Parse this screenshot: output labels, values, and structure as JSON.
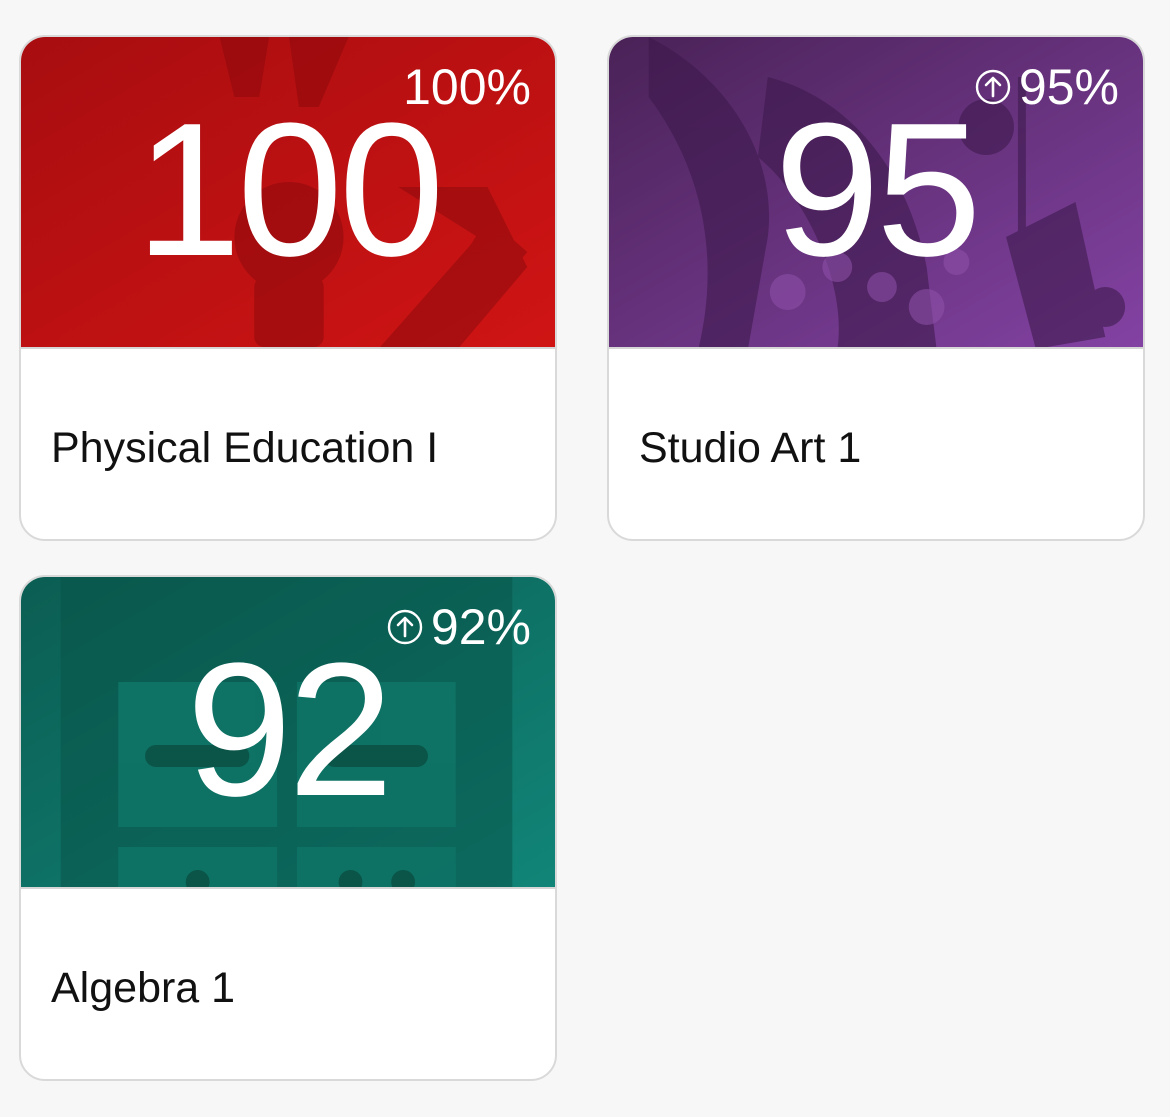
{
  "courses": [
    {
      "name": "Physical Education I",
      "grade": "100",
      "percent": "100%",
      "trend": "none",
      "color": "#c01114",
      "icon": "trophy-icon"
    },
    {
      "name": "Studio Art 1",
      "grade": "95",
      "percent": "95%",
      "trend": "up",
      "color": "#6a3490",
      "icon": "theater-mask-music-icon"
    },
    {
      "name": "Algebra 1",
      "grade": "92",
      "percent": "92%",
      "trend": "up",
      "color": "#0f7a6c",
      "icon": "calculator-icon"
    }
  ],
  "icons": {
    "trend_up": "arrow-up-circle-icon"
  }
}
